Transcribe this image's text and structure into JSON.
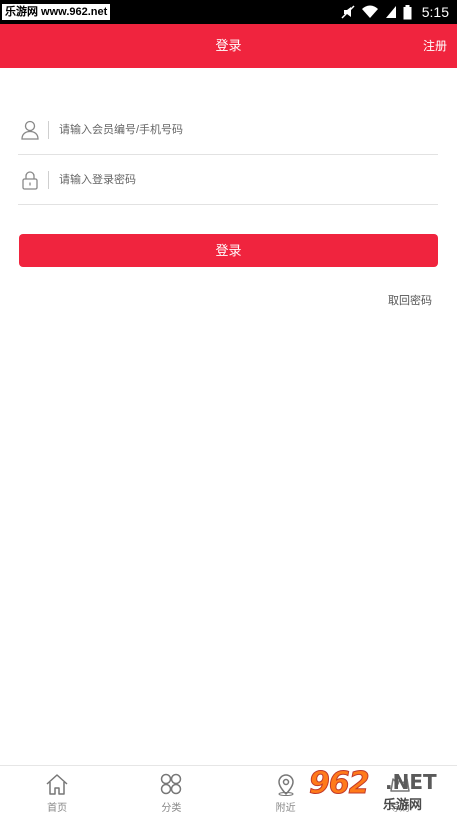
{
  "status_bar": {
    "watermark_tag": "乐游网 www.962.net",
    "time": "5:15"
  },
  "header": {
    "title": "登录",
    "register_label": "注册"
  },
  "form": {
    "account_placeholder": "请输入会员编号/手机号码",
    "password_placeholder": "请输入登录密码",
    "login_button": "登录",
    "forgot_password": "取回密码"
  },
  "bottom_nav": {
    "items": [
      {
        "label": "首页",
        "icon": "home-icon"
      },
      {
        "label": "分类",
        "icon": "category-icon"
      },
      {
        "label": "附近",
        "icon": "location-icon"
      },
      {
        "label": "导购",
        "icon": "guide-icon"
      }
    ]
  },
  "watermark": {
    "big": "962",
    "net": ".NET",
    "sub": "乐游网"
  },
  "colors": {
    "accent": "#f0243e",
    "status_bar": "#000000"
  }
}
